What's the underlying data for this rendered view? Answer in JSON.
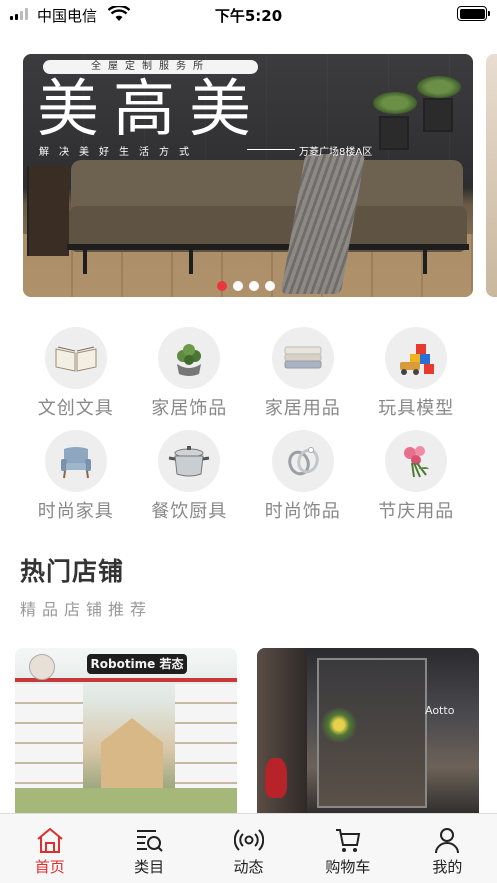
{
  "status_bar": {
    "carrier": "中国电信",
    "time": "下午5:20"
  },
  "banner": {
    "tagline": "全屋定制服务所",
    "title": "美高美",
    "slogan": "解决美好生活方式",
    "address": "万菱广场8楼A区",
    "dot_count": 4,
    "active_dot": 0
  },
  "categories": [
    {
      "label": "文创文具",
      "icon": "book-icon"
    },
    {
      "label": "家居饰品",
      "icon": "potted-plant-icon"
    },
    {
      "label": "家居用品",
      "icon": "towels-icon"
    },
    {
      "label": "玩具模型",
      "icon": "toy-blocks-icon"
    },
    {
      "label": "时尚家具",
      "icon": "armchair-icon"
    },
    {
      "label": "餐饮厨具",
      "icon": "cooking-pot-icon"
    },
    {
      "label": "时尚饰品",
      "icon": "rings-icon"
    },
    {
      "label": "节庆用品",
      "icon": "flowers-icon"
    }
  ],
  "hot_shops": {
    "title": "热门店铺",
    "subtitle": "精品店铺推荐",
    "shops": [
      {
        "sign": "Robotime 若态"
      },
      {
        "sign": "Aotto"
      }
    ]
  },
  "tab_bar": {
    "active": 0,
    "tabs": [
      {
        "label": "首页",
        "icon": "home-icon"
      },
      {
        "label": "类目",
        "icon": "category-search-icon"
      },
      {
        "label": "动态",
        "icon": "broadcast-icon"
      },
      {
        "label": "购物车",
        "icon": "cart-icon"
      },
      {
        "label": "我的",
        "icon": "user-icon"
      }
    ]
  },
  "colors": {
    "accent": "#e02e2e",
    "category_circle": "#eeeeee",
    "category_label": "#888888"
  }
}
